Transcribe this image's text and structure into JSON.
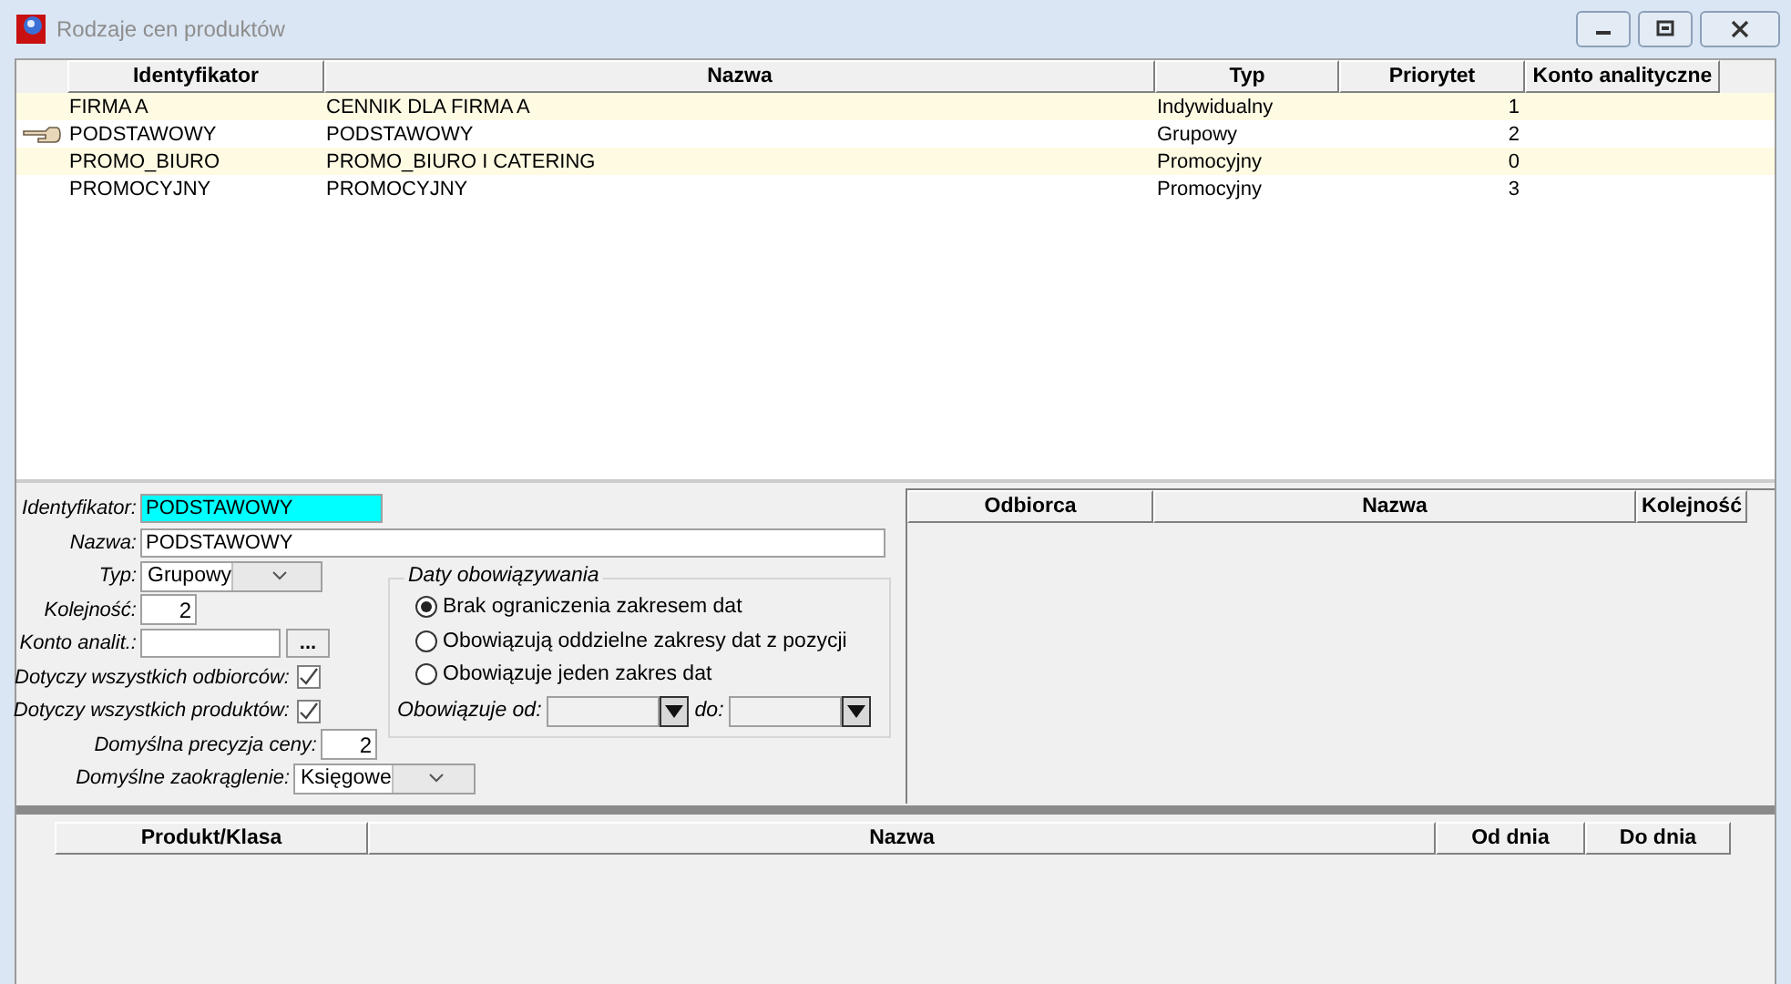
{
  "window": {
    "title": "Rodzaje cen produktów"
  },
  "price_types": {
    "columns": [
      "Identyfikator",
      "Nazwa",
      "Typ",
      "Priorytet",
      "Konto analityczne"
    ],
    "rows": [
      {
        "id": "FIRMA A",
        "name": "CENNIK DLA FIRMA A",
        "type": "Indywidualny",
        "priority": "1",
        "current": false
      },
      {
        "id": "PODSTAWOWY",
        "name": "PODSTAWOWY",
        "type": "Grupowy",
        "priority": "2",
        "current": true
      },
      {
        "id": "PROMO_BIURO",
        "name": "PROMO_BIURO I CATERING",
        "type": "Promocyjny",
        "priority": "0",
        "current": false
      },
      {
        "id": "PROMOCYJNY",
        "name": "PROMOCYJNY",
        "type": "Promocyjny",
        "priority": "3",
        "current": false
      }
    ]
  },
  "form": {
    "fields": [
      {
        "kind": "text",
        "label": "Identyfikator:",
        "value": "PODSTAWOWY",
        "highlighted": true
      },
      {
        "kind": "text",
        "label": "Nazwa:",
        "value": "PODSTAWOWY",
        "highlighted": false
      },
      {
        "kind": "combo",
        "label": "Typ:",
        "value": "Grupowy"
      },
      {
        "kind": "spin",
        "label": "Kolejność:",
        "value": "2"
      },
      {
        "kind": "lookup",
        "label": "Konto analit.:",
        "button": "..."
      },
      {
        "kind": "checkbox",
        "label": "Dotyczy wszystkich odbiorców:",
        "checked": true
      },
      {
        "kind": "checkbox",
        "label": "Dotyczy wszystkich produktów:",
        "checked": true
      },
      {
        "kind": "spin",
        "label": "Domyślna precyzja ceny:",
        "value": "2"
      },
      {
        "kind": "combo",
        "label": "Domyślne zaokrąglenie:",
        "value": "Księgowe"
      }
    ],
    "dates": {
      "title": "Daty obowiązywania",
      "options": [
        {
          "label": "Brak ograniczenia zakresem dat",
          "selected": true
        },
        {
          "label": "Obowiązują oddzielne zakresy dat z pozycji",
          "selected": false
        },
        {
          "label": "Obowiązuje jeden zakres dat",
          "selected": false
        }
      ],
      "from_label": "Obowiązuje od:",
      "to_label": "do:"
    }
  },
  "customers": {
    "columns": [
      "Odbiorca",
      "Nazwa",
      "Kolejność"
    ]
  },
  "products": {
    "columns": [
      "Produkt/Klasa",
      "Nazwa",
      "Od dnia",
      "Do dnia"
    ]
  }
}
